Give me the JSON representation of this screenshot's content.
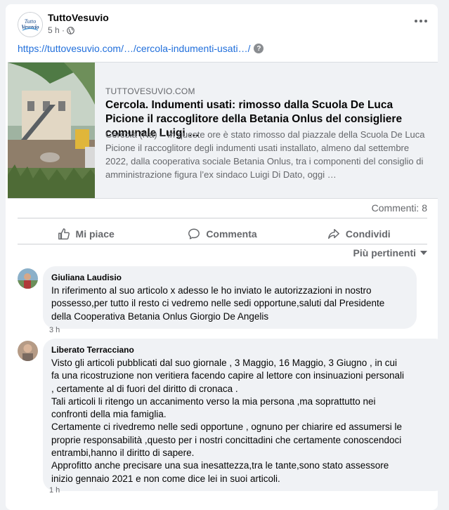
{
  "post": {
    "page_name": "TuttoVesuvio",
    "time": "5 h ·",
    "privacy_icon": "globe-icon",
    "link_text": "https://tuttovesuvio.com/…/cercola-indumenti-usati…/",
    "help_icon_glyph": "?"
  },
  "logo": {
    "line1": "Tutto",
    "line2": "Vesuvio"
  },
  "link_preview": {
    "domain": "TUTTOVESUVIO.COM",
    "title": "Cercola. Indumenti usati: rimosso dalla Scuola De Luca Picione il raccoglitore della Betania Onlus del consigliere comunale Luigi …",
    "description": "Cercola (Na) – In queste ore è stato rimosso dal piazzale della Scuola De Luca Picione il raccoglitore degli indumenti usati installato, almeno dal settembre 2022, dalla cooperativa sociale Betania Onlus, tra i componenti del consiglio di amministrazione figura l’ex sindaco Luigi Di Dato, oggi …"
  },
  "stats": {
    "comments": "Commenti: 8"
  },
  "actions": {
    "like": "Mi piace",
    "comment": "Commenta",
    "share": "Condividi"
  },
  "sort": {
    "label": "Più pertinenti"
  },
  "comments": [
    {
      "author": "Giuliana Laudisio",
      "text": "In riferimento al suo articolo x adesso le ho inviato le autorizzazioni in nostro\npossesso,per tutto il resto ci vedremo nelle sedi opportune,saluti dal Presidente\ndella Cooperativa Betania Onlus Giorgio De Angelis",
      "time": "3 h"
    },
    {
      "author": "Liberato Terracciano",
      "text": "Visto gli articoli pubblicati dal suo giornale , 3 Maggio, 16 Maggio, 3 Giugno , in cui\nfa una ricostruzione non veritiera facendo capire al lettore con insinuazioni personali\n, certamente al di fuori del diritto di cronaca .\nTali articoli li ritengo un accanimento verso la mia persona ,ma soprattutto nei\nconfronti della mia famiglia.\nCertamente ci rivedremo nelle sedi opportune , ognuno per chiarire ed assumersi le\nproprie responsabilità ,questo per i nostri concittadini che certamente conoscendoci\nentrambi,hanno il diritto di sapere.\nApprofitto anche precisare una sua inesattezza,tra le tante,sono stato assessore\ninizio gennaio 2021 e non come dice lei in suoi articoli.",
      "time": "1 h"
    }
  ],
  "colors": {
    "link": "#216fdb",
    "secondary_text": "#65676b",
    "bubble_bg": "#f0f2f5"
  }
}
